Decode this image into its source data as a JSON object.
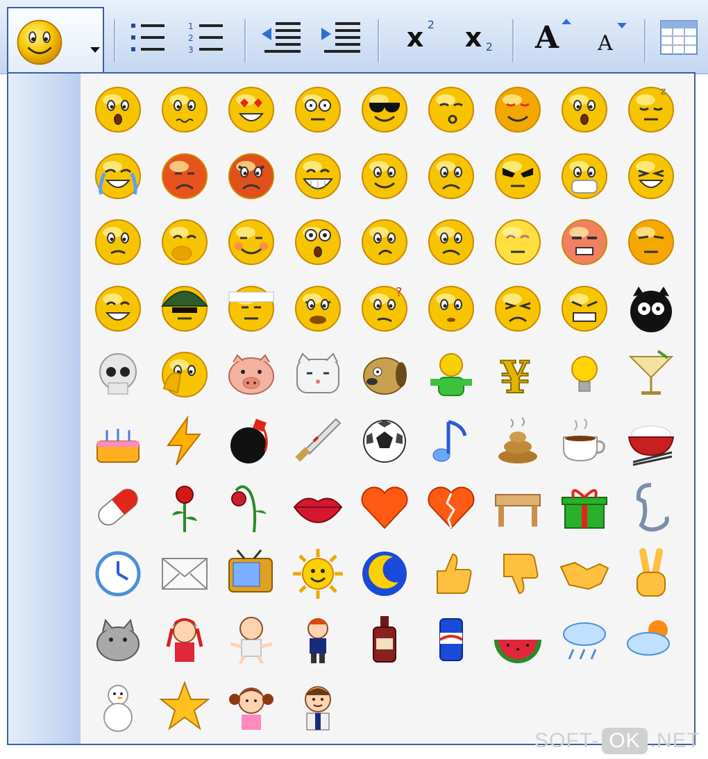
{
  "toolbar": {
    "buttons": [
      {
        "name": "emoticon-button",
        "icon": "smiley-icon"
      },
      {
        "name": "bulleted-list-button",
        "icon": "bulleted-list-icon"
      },
      {
        "name": "numbered-list-button",
        "icon": "numbered-list-icon"
      },
      {
        "name": "decrease-indent-button",
        "icon": "outdent-icon"
      },
      {
        "name": "increase-indent-button",
        "icon": "indent-icon"
      },
      {
        "name": "superscript-button",
        "icon": "superscript-icon"
      },
      {
        "name": "subscript-button",
        "icon": "subscript-icon"
      },
      {
        "name": "increase-font-button",
        "icon": "font-grow-icon"
      },
      {
        "name": "decrease-font-button",
        "icon": "font-shrink-icon"
      },
      {
        "name": "table-button",
        "icon": "table-icon"
      }
    ],
    "superscript_glyph": "x",
    "superscript_mark": "2",
    "subscript_glyph": "x",
    "subscript_mark": "2",
    "grow_glyph": "A",
    "shrink_glyph": "A"
  },
  "emoticons": [
    "shocked-icon",
    "worried-icon",
    "love-eyes-icon",
    "staring-icon",
    "cool-sunglasses-icon",
    "whistle-icon",
    "shy-icon",
    "surprised-icon",
    "sleepy-icon",
    "crying-icon",
    "sad-red-icon",
    "angry-icon",
    "big-grin-icon",
    "smile-icon",
    "frown-icon",
    "evil-icon",
    "sick-mask-icon",
    "annoyed-icon",
    "nervous-icon",
    "giggle-icon",
    "blush-icon",
    "scared-icon",
    "thinking-icon",
    "awkward-icon",
    "dizzy-icon",
    "furious-icon",
    "smug-icon",
    "laugh-icon",
    "soldier-icon",
    "bandage-icon",
    "grumpy-icon",
    "confused-icon",
    "blank-icon",
    "pained-icon",
    "grimace-icon",
    "black-cat-icon",
    "skull-icon",
    "facepalm-icon",
    "pig-icon",
    "cat-icon",
    "dog-icon",
    "person-icon",
    "money-icon",
    "lightbulb-icon",
    "cocktail-icon",
    "birthday-cake-icon",
    "lightning-icon",
    "bomb-icon",
    "knife-icon",
    "soccer-ball-icon",
    "music-note-icon",
    "poop-icon",
    "coffee-icon",
    "rice-bowl-icon",
    "pill-icon",
    "rose-icon",
    "wilted-rose-icon",
    "lips-icon",
    "heart-icon",
    "broken-heart-icon",
    "table-icon",
    "gift-icon",
    "phone-icon",
    "clock-icon",
    "envelope-icon",
    "tv-icon",
    "sun-icon",
    "moon-icon",
    "thumbs-up-icon",
    "thumbs-down-icon",
    "handshake-icon",
    "victory-icon",
    "cat-grey-icon",
    "girl-red-icon",
    "baby-icon",
    "boy-icon",
    "bottle-icon",
    "soda-can-icon",
    "watermelon-icon",
    "rain-cloud-icon",
    "sun-cloud-icon",
    "snowman-icon",
    "star-icon",
    "girl-pigtails-icon",
    "man-icon"
  ],
  "colors": {
    "face_yellow": "#f7c400",
    "face_light": "#ffef7a",
    "face_outline": "#c98a00",
    "popup_border": "#3b5f9f",
    "toolbar_blue": "#1f4e9c"
  },
  "watermark": {
    "left": "SOFT-",
    "box": "OK",
    "right": ".NET"
  }
}
